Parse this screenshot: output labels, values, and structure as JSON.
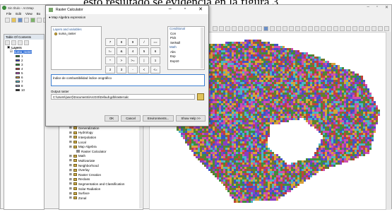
{
  "doc_text": "ésto resultado se evidencia en la figura 3.",
  "app": {
    "title": "Sin título - ArcMap",
    "menus": [
      "File",
      "Edit",
      "View",
      "Bo"
    ],
    "window_controls": [
      "–",
      "▫",
      "✕"
    ]
  },
  "toc": {
    "title": "Table Of Contents",
    "root_label": "Layers",
    "selected_layer": "suma_raster",
    "legend": [
      {
        "label": "1",
        "color": "#2b8a2b"
      },
      {
        "label": "2",
        "color": "#3a3ad8"
      },
      {
        "label": "3",
        "color": "#1c9e1c"
      },
      {
        "label": "4",
        "color": "#d93a3a"
      },
      {
        "label": "5",
        "color": "#d84bd8"
      },
      {
        "label": "6",
        "color": "#e0a030"
      },
      {
        "label": "7",
        "color": "#4ec7d8"
      },
      {
        "label": "8",
        "color": "#b0b0e0"
      },
      {
        "label": "10",
        "color": "#222222"
      }
    ]
  },
  "toolbox": {
    "items": [
      {
        "label": "Generalization",
        "level": 1
      },
      {
        "label": "Hydrology",
        "level": 1
      },
      {
        "label": "Interpolation",
        "level": 1
      },
      {
        "label": "Local",
        "level": 1
      },
      {
        "label": "Map Algebra",
        "level": 1
      },
      {
        "label": "Raster Calculator",
        "level": 2
      },
      {
        "label": "Math",
        "level": 1
      },
      {
        "label": "Multivariate",
        "level": 1
      },
      {
        "label": "Neighborhood",
        "level": 1
      },
      {
        "label": "Overlay",
        "level": 1
      },
      {
        "label": "Raster Creation",
        "level": 1
      },
      {
        "label": "Reclass",
        "level": 1
      },
      {
        "label": "Segmentation and Classification",
        "level": 1
      },
      {
        "label": "Solar Radiation",
        "level": 1
      },
      {
        "label": "Surface",
        "level": 1
      },
      {
        "label": "Zonal",
        "level": 1
      }
    ]
  },
  "dialog": {
    "title": "Raster Calculator",
    "section_label": "Map Algebra expression",
    "layers_title": "Layers and variables",
    "layer_items": [
      "suma_raster"
    ],
    "keypad": [
      "7",
      "8",
      "9",
      "/",
      "==",
      "!=",
      "&",
      "4",
      "5",
      "6",
      "*",
      ">",
      ">=",
      "|",
      "1",
      "2",
      "3",
      "-",
      "<",
      "<=",
      "^",
      "0",
      ".",
      "+",
      "(",
      ")",
      "~"
    ],
    "conditional_title": "Conditional",
    "conditional_items": [
      "Con",
      "Pick",
      "SetNull"
    ],
    "math_title": "Math",
    "math_items": [
      "Abs",
      "Exp",
      "Exp10"
    ],
    "expression": "Índice de combustibilidad índice orográfico",
    "output_label": "Output raster",
    "output_value": "C:\\Users\\(user)\\Documents\\ArcGIS\\Default.gdb\\rastercalc",
    "buttons": {
      "ok": "OK",
      "cancel": "Cancel",
      "env": "Environments...",
      "help": "Show Help >>"
    }
  },
  "colors": {
    "selection": "#3874d8",
    "expression_border": "#3c7fd1",
    "map_palette": [
      "#c1413a",
      "#d9a23a",
      "#3e8e3e",
      "#3d55c4",
      "#8a3ec4",
      "#ce4fb0",
      "#49b6c7",
      "#6d7a2b"
    ]
  }
}
